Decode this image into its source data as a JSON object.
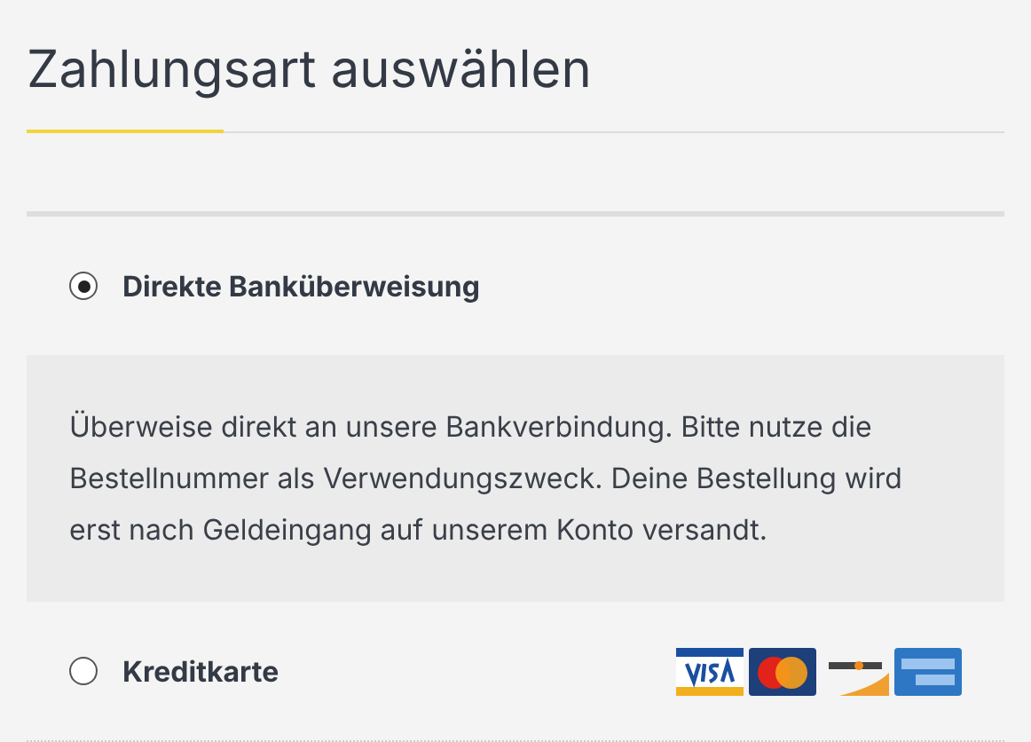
{
  "title": "Zahlungsart auswählen",
  "methods": [
    {
      "label": "Direkte Banküberweisung",
      "selected": true,
      "description": "Überweise direkt an unsere Bankverbindung. Bitte nutze die Bestellnummer als Verwendungszweck. Deine Bestellung wird erst nach Geldeingang auf unserem Konto versandt."
    },
    {
      "label": "Kreditkarte",
      "selected": false,
      "cards": true
    }
  ]
}
